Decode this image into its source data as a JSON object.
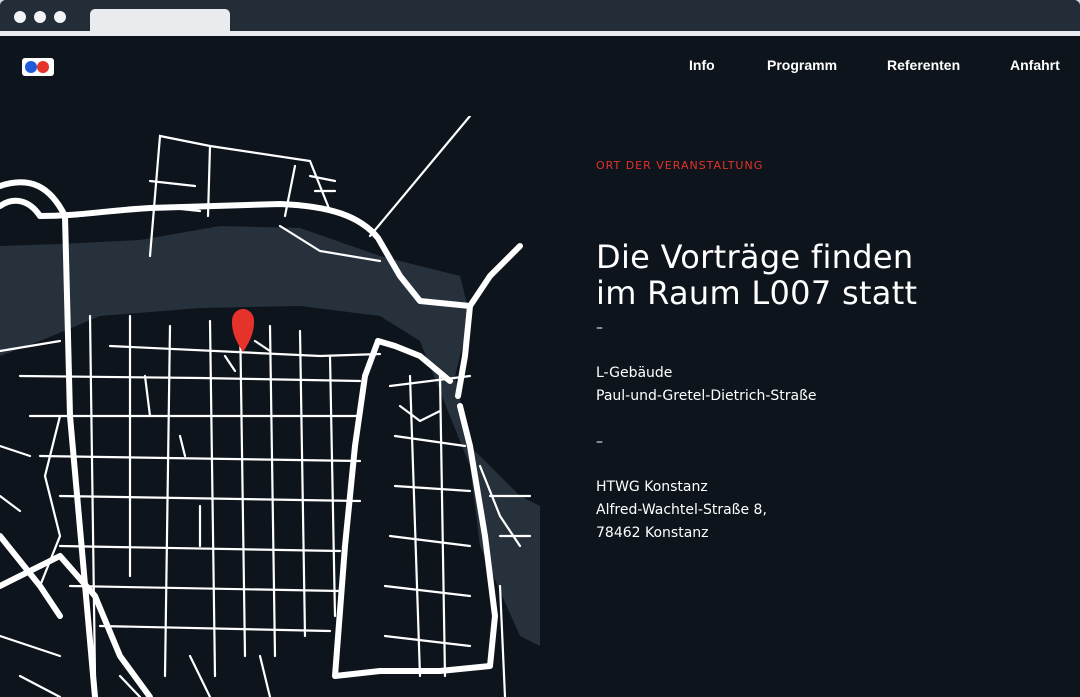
{
  "nav": {
    "items": [
      "Info",
      "Programm",
      "Referenten",
      "Anfahrt"
    ]
  },
  "location": {
    "eyebrow": "ORT DER VERANSTALTUNG",
    "headline_line1": "Die Vorträge finden",
    "headline_line2": "im Raum L007 statt",
    "separator": "–",
    "building": "L-Gebäude",
    "building_street": "Paul-und-Gretel-Dietrich-Straße",
    "org": "HTWG Konstanz",
    "street": "Alfred-Wachtel-Straße 8,",
    "city": "78462 Konstanz"
  },
  "colors": {
    "background": "#0e141c",
    "accent": "#e5322a",
    "river": "#26313b",
    "roads": "#ffffff"
  }
}
